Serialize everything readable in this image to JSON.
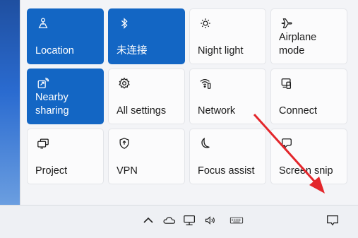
{
  "quick_settings": {
    "tiles": [
      {
        "label": "Location",
        "icon": "location-icon",
        "active": true
      },
      {
        "label": "未连接",
        "icon": "bluetooth-icon",
        "active": true
      },
      {
        "label": "Night light",
        "icon": "night-light-icon",
        "active": false
      },
      {
        "label": "Airplane\nmode",
        "icon": "airplane-icon",
        "active": false
      },
      {
        "label": "Nearby\nsharing",
        "icon": "nearby-sharing-icon",
        "active": true
      },
      {
        "label": "All settings",
        "icon": "gear-icon",
        "active": false
      },
      {
        "label": "Network",
        "icon": "network-icon",
        "active": false
      },
      {
        "label": "Connect",
        "icon": "connect-icon",
        "active": false
      },
      {
        "label": "Project",
        "icon": "project-icon",
        "active": false
      },
      {
        "label": "VPN",
        "icon": "vpn-shield-icon",
        "active": false
      },
      {
        "label": "Focus assist",
        "icon": "moon-icon",
        "active": false
      },
      {
        "label": "Screen snip",
        "icon": "screen-snip-icon",
        "active": false
      }
    ]
  },
  "taskbar": {
    "tray_icons": [
      "chevron-up-icon",
      "onedrive-cloud-icon",
      "network-pc-icon",
      "volume-icon",
      "keyboard-icon",
      "action-center-icon"
    ]
  },
  "colors": {
    "accent": "#1366c4",
    "annotation_arrow": "#e3262b"
  }
}
